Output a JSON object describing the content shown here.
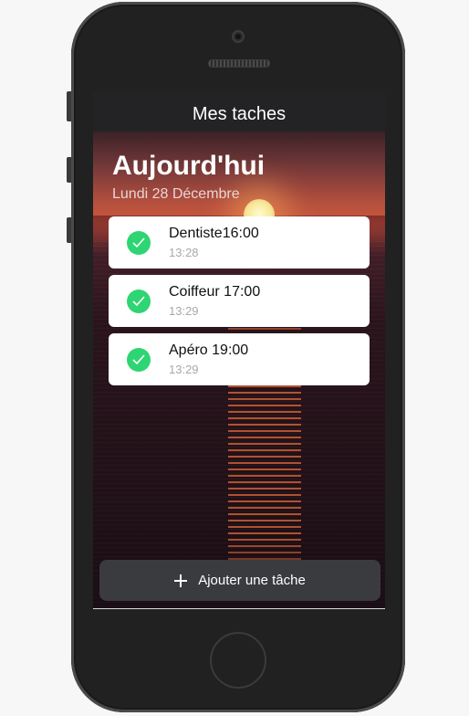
{
  "header": {
    "title": "Mes taches"
  },
  "today": {
    "title": "Aujourd'hui",
    "date": "Lundi 28 Décembre"
  },
  "tasks": [
    {
      "name": "Dentiste16:00",
      "time": "13:28",
      "done": true
    },
    {
      "name": "Coiffeur 17:00",
      "time": "13:29",
      "done": true
    },
    {
      "name": "Apéro 19:00",
      "time": "13:29",
      "done": true
    }
  ],
  "add_button": {
    "label": "Ajouter une tâche",
    "icon": "plus-icon"
  },
  "colors": {
    "check": "#2ed573",
    "card": "#ffffff",
    "header": "#232325",
    "button": "#3a3b3e"
  }
}
